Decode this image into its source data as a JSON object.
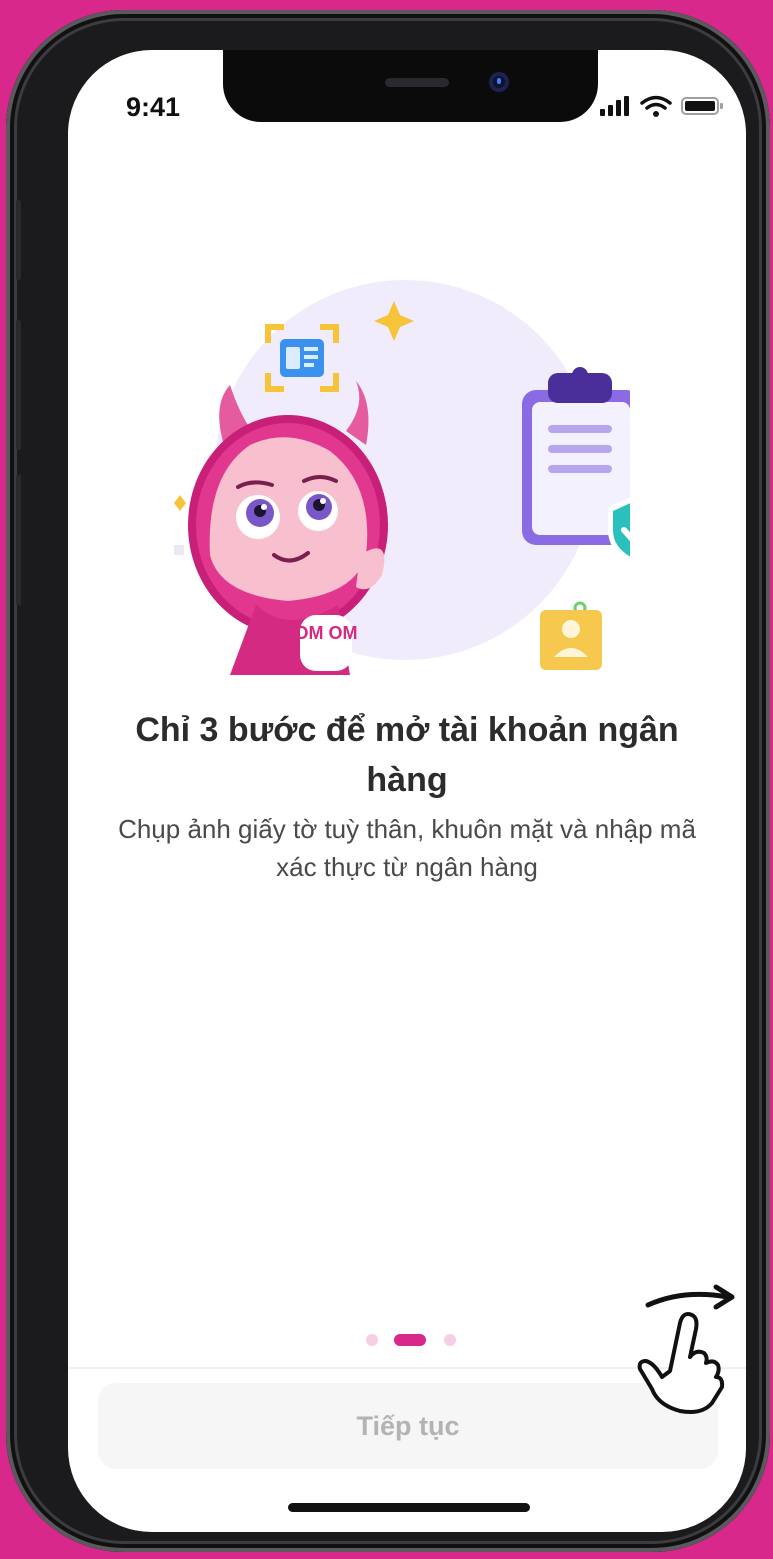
{
  "status_bar": {
    "time": "9:41"
  },
  "illustration": {
    "mascot_badge": "OM OM"
  },
  "onboarding": {
    "title": "Chỉ 3 bước để mở tài khoản ngân hàng",
    "subtitle": "Chụp ảnh giấy tờ tuỳ thân, khuôn mặt và nhập mã xác thực từ ngân hàng",
    "page_indicator": {
      "total": 3,
      "current": 2
    }
  },
  "actions": {
    "continue_label": "Tiếp tục"
  },
  "colors": {
    "brand_pink": "#d9288b",
    "disabled_button_bg": "#f6f6f6",
    "disabled_text": "#b3b3b3"
  }
}
